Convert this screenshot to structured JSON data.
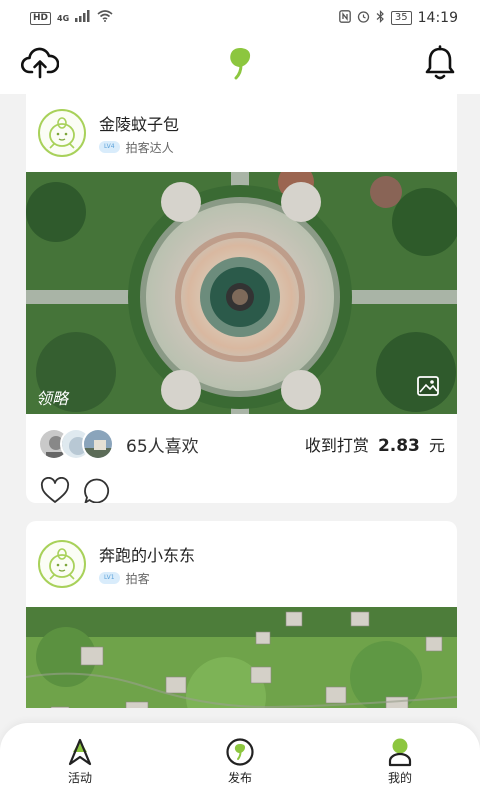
{
  "status_bar": {
    "hd": "HD",
    "network": "4G",
    "battery": "35",
    "time": "14:19"
  },
  "header": {
    "upload_icon": "cloud-upload-icon",
    "logo_icon": "leaf-logo-icon",
    "bell_icon": "bell-icon",
    "accent_color": "#8cc63f"
  },
  "feed": {
    "posts": [
      {
        "author": "金陵蚊子包",
        "level_badge": "LV4",
        "level_title": "拍客达人",
        "likes_text": "65人喜欢",
        "tip_prefix": "收到打赏",
        "tip_amount": "2.83",
        "tip_unit": "元",
        "watermark": "领略"
      },
      {
        "author": "奔跑的小东东",
        "level_badge": "LV1",
        "level_title": "拍客"
      }
    ]
  },
  "tabbar": {
    "tabs": [
      {
        "label": "活动",
        "icon": "compass-arrow-icon"
      },
      {
        "label": "发布",
        "icon": "publish-icon"
      },
      {
        "label": "我的",
        "icon": "profile-icon"
      }
    ]
  }
}
